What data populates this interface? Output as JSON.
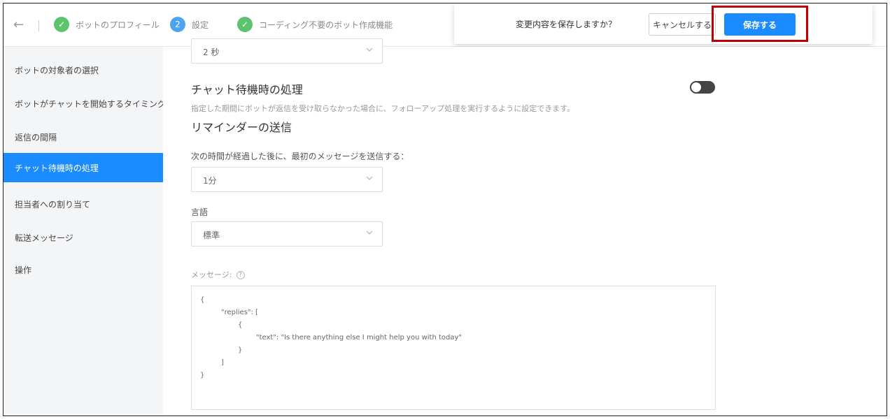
{
  "nav": {
    "back_icon": "arrow-left-icon",
    "steps": [
      {
        "label": "ボットのプロフィール",
        "state": "done",
        "marker": "✓"
      },
      {
        "label": "設定",
        "state": "active",
        "marker": "2"
      },
      {
        "label": "コーディング不要のボット作成機能",
        "state": "done",
        "marker": "✓"
      }
    ]
  },
  "save_dialog": {
    "question": "変更内容を保存しますか？",
    "cancel_label": "キャンセルする",
    "save_label": "保存する"
  },
  "sidebar": {
    "items": [
      {
        "label": "ボットの対象者の選択",
        "active": false
      },
      {
        "label": "ボットがチャットを開始するタイミング",
        "active": false
      },
      {
        "label": "返信の間隔",
        "active": false
      },
      {
        "label": "チャット待機時の処理",
        "active": true
      },
      {
        "label": "担当者への割り当て",
        "active": false
      },
      {
        "label": "転送メッセージ",
        "active": false
      },
      {
        "label": "操作",
        "active": false
      }
    ]
  },
  "main": {
    "interval_select": {
      "value": "2 秒"
    },
    "idle_section": {
      "title": "チャット待機時の処理",
      "description": "指定した期間にボットが返信を受け取らなかった場合に、フォローアップ処理を実行するように設定できます。",
      "toggle_on": false
    },
    "reminder": {
      "title": "リマインダーの送信",
      "delay_label": "次の時間が経過した後に、最初のメッセージを送信する：",
      "delay_value": "1分",
      "language_label": "言語",
      "language_value": "標準",
      "message_label": "メッセージ:",
      "message_help_icon": "question-circle-icon",
      "message_lines": [
        "{",
        "\"replies\": [",
        "{",
        "\"text\": \"Is there anything else I might help you with today\"",
        "}",
        "]",
        "}"
      ]
    }
  },
  "colors": {
    "accent": "#1a8cff",
    "step_done": "#5cc46d",
    "step_active": "#4ca3ee",
    "highlight_box": "#c00000",
    "sidebar_bg": "#f4f5f7"
  }
}
